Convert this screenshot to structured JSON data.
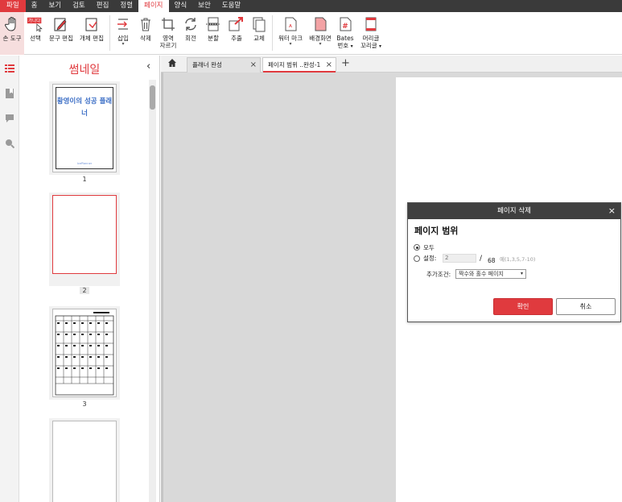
{
  "menubar": {
    "items": [
      "파일",
      "홈",
      "보기",
      "검토",
      "편집",
      "정렬",
      "페이지",
      "양식",
      "보안",
      "도움말"
    ],
    "active_index": 6
  },
  "ribbon": {
    "hand_tool": "손 도구",
    "select": "선택",
    "select_badge": "가나다",
    "text_edit": "문구 편집",
    "object_edit": "개체 편집",
    "insert": "삽입",
    "delete": "삭제",
    "crop_line1": "영역",
    "crop_line2": "자르기",
    "rotate": "회전",
    "split": "분할",
    "extract": "추출",
    "replace": "교체",
    "watermark": "워터 마크",
    "background": "배경화면",
    "bates_line1": "Bates",
    "bates_line2": "번호",
    "header_footer_line1": "머리글",
    "header_footer_line2": "꼬리글"
  },
  "thumbnails": {
    "title": "썸네일",
    "page1_title": "황영이의 성공 플래너",
    "page1_footer": "IcePlanner",
    "pages": [
      {
        "number": "1"
      },
      {
        "number": "2"
      },
      {
        "number": "3"
      }
    ]
  },
  "tabs": [
    {
      "label": "플래너 완성"
    },
    {
      "label": "페이지 범위 ..완성-1"
    }
  ],
  "dialog": {
    "title": "페이지 삭제",
    "subtitle": "페이지 범위",
    "option_all": "모두",
    "option_custom": "설정:",
    "range_value": "2",
    "range_sep": "/",
    "total_pages": "68",
    "range_hint": "예(1,3,5,7-10)",
    "condition_label": "추가조건:",
    "condition_value": "짝수와 홀수 페이지",
    "ok": "확인",
    "cancel": "취소"
  },
  "colors": {
    "accent": "#e03a3e",
    "menubar": "#3a3a3a",
    "dialog_header": "#3f3f3f"
  }
}
